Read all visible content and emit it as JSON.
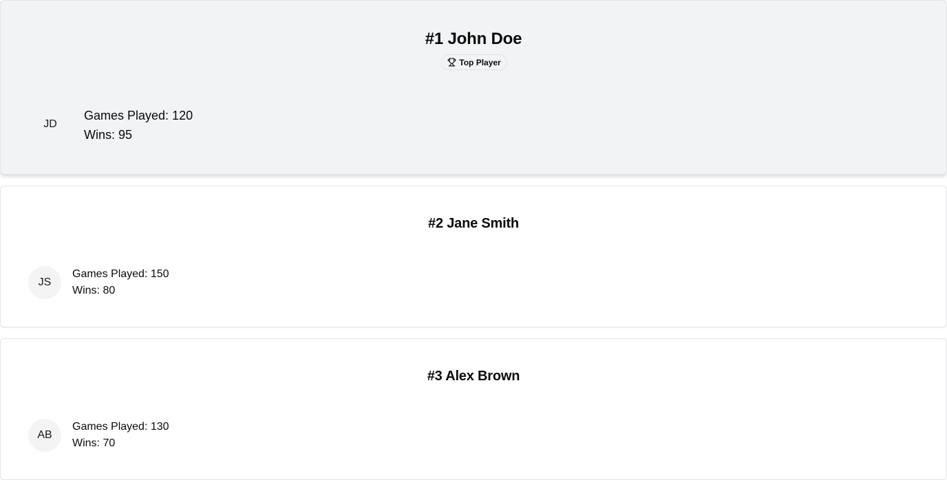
{
  "players": [
    {
      "rank_title": "#1 John Doe",
      "badge": {
        "icon": "trophy-icon",
        "label": "Top Player"
      },
      "initials": "JD",
      "games_played": "Games Played: 120",
      "wins": "Wins: 95"
    },
    {
      "rank_title": "#2 Jane Smith",
      "initials": "JS",
      "games_played": "Games Played: 150",
      "wins": "Wins: 80"
    },
    {
      "rank_title": "#3 Alex Brown",
      "initials": "AB",
      "games_played": "Games Played: 130",
      "wins": "Wins: 70"
    }
  ],
  "colors": {
    "top_card_bg": "#f2f3f5",
    "card_bg": "#ffffff",
    "border": "#e4e4e7",
    "avatar_bg": "#f4f4f5"
  }
}
